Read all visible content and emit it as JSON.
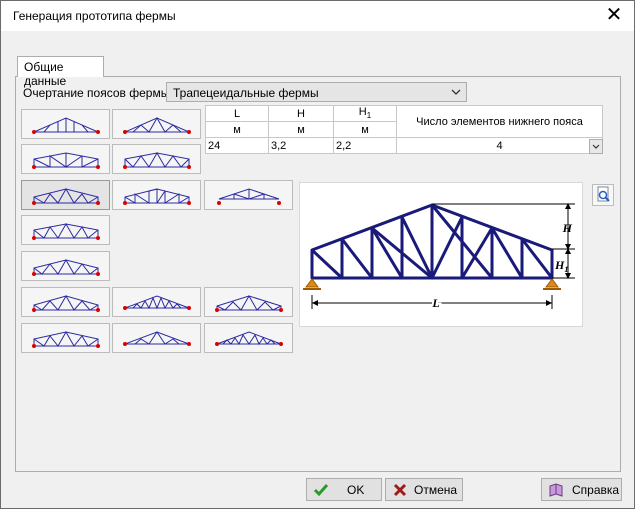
{
  "window": {
    "title": "Генерация прототипа фермы"
  },
  "tab": {
    "label": "Общие данные"
  },
  "chord": {
    "label": "Очертание поясов фермы",
    "value": "Трапецеидальные фермы"
  },
  "table": {
    "headers": [
      "L",
      "H",
      "H1",
      "Число элементов нижнего пояса"
    ],
    "units": [
      "м",
      "м",
      "м"
    ],
    "values": [
      "24",
      "3,2",
      "2,2",
      "4"
    ]
  },
  "buttons": {
    "ok": "OK",
    "cancel": "Отмена",
    "help": "Справка"
  },
  "diagram": {
    "H": "H",
    "H1": "H1",
    "L": "L"
  }
}
